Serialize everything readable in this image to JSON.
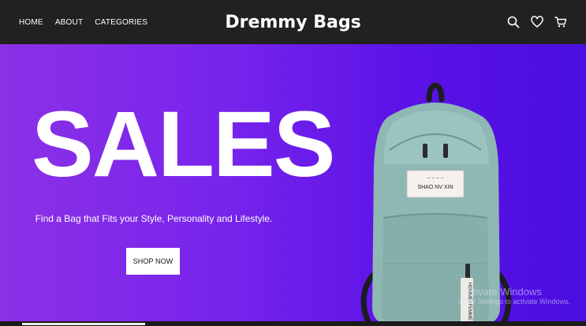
{
  "header": {
    "nav": [
      "HOME",
      "ABOUT",
      "CATEGORIES"
    ],
    "brand": "Dremmy Bags",
    "icons": [
      "search-icon",
      "heart-icon",
      "cart-icon"
    ]
  },
  "hero": {
    "headline": "SALES",
    "tagline": "Find a Bag that Fits your Style, Personality and Lifestyle.",
    "cta_label": "SHOP NOW",
    "product_tag": "SHAO NV XIN",
    "strap_text": "HOMME+FEMME",
    "gradient_colors": [
      "#8c31e6",
      "#4a0ee0"
    ]
  },
  "watermark": {
    "line1": "ctivate Windows",
    "line2": "Go to Settings to activate Windows."
  }
}
